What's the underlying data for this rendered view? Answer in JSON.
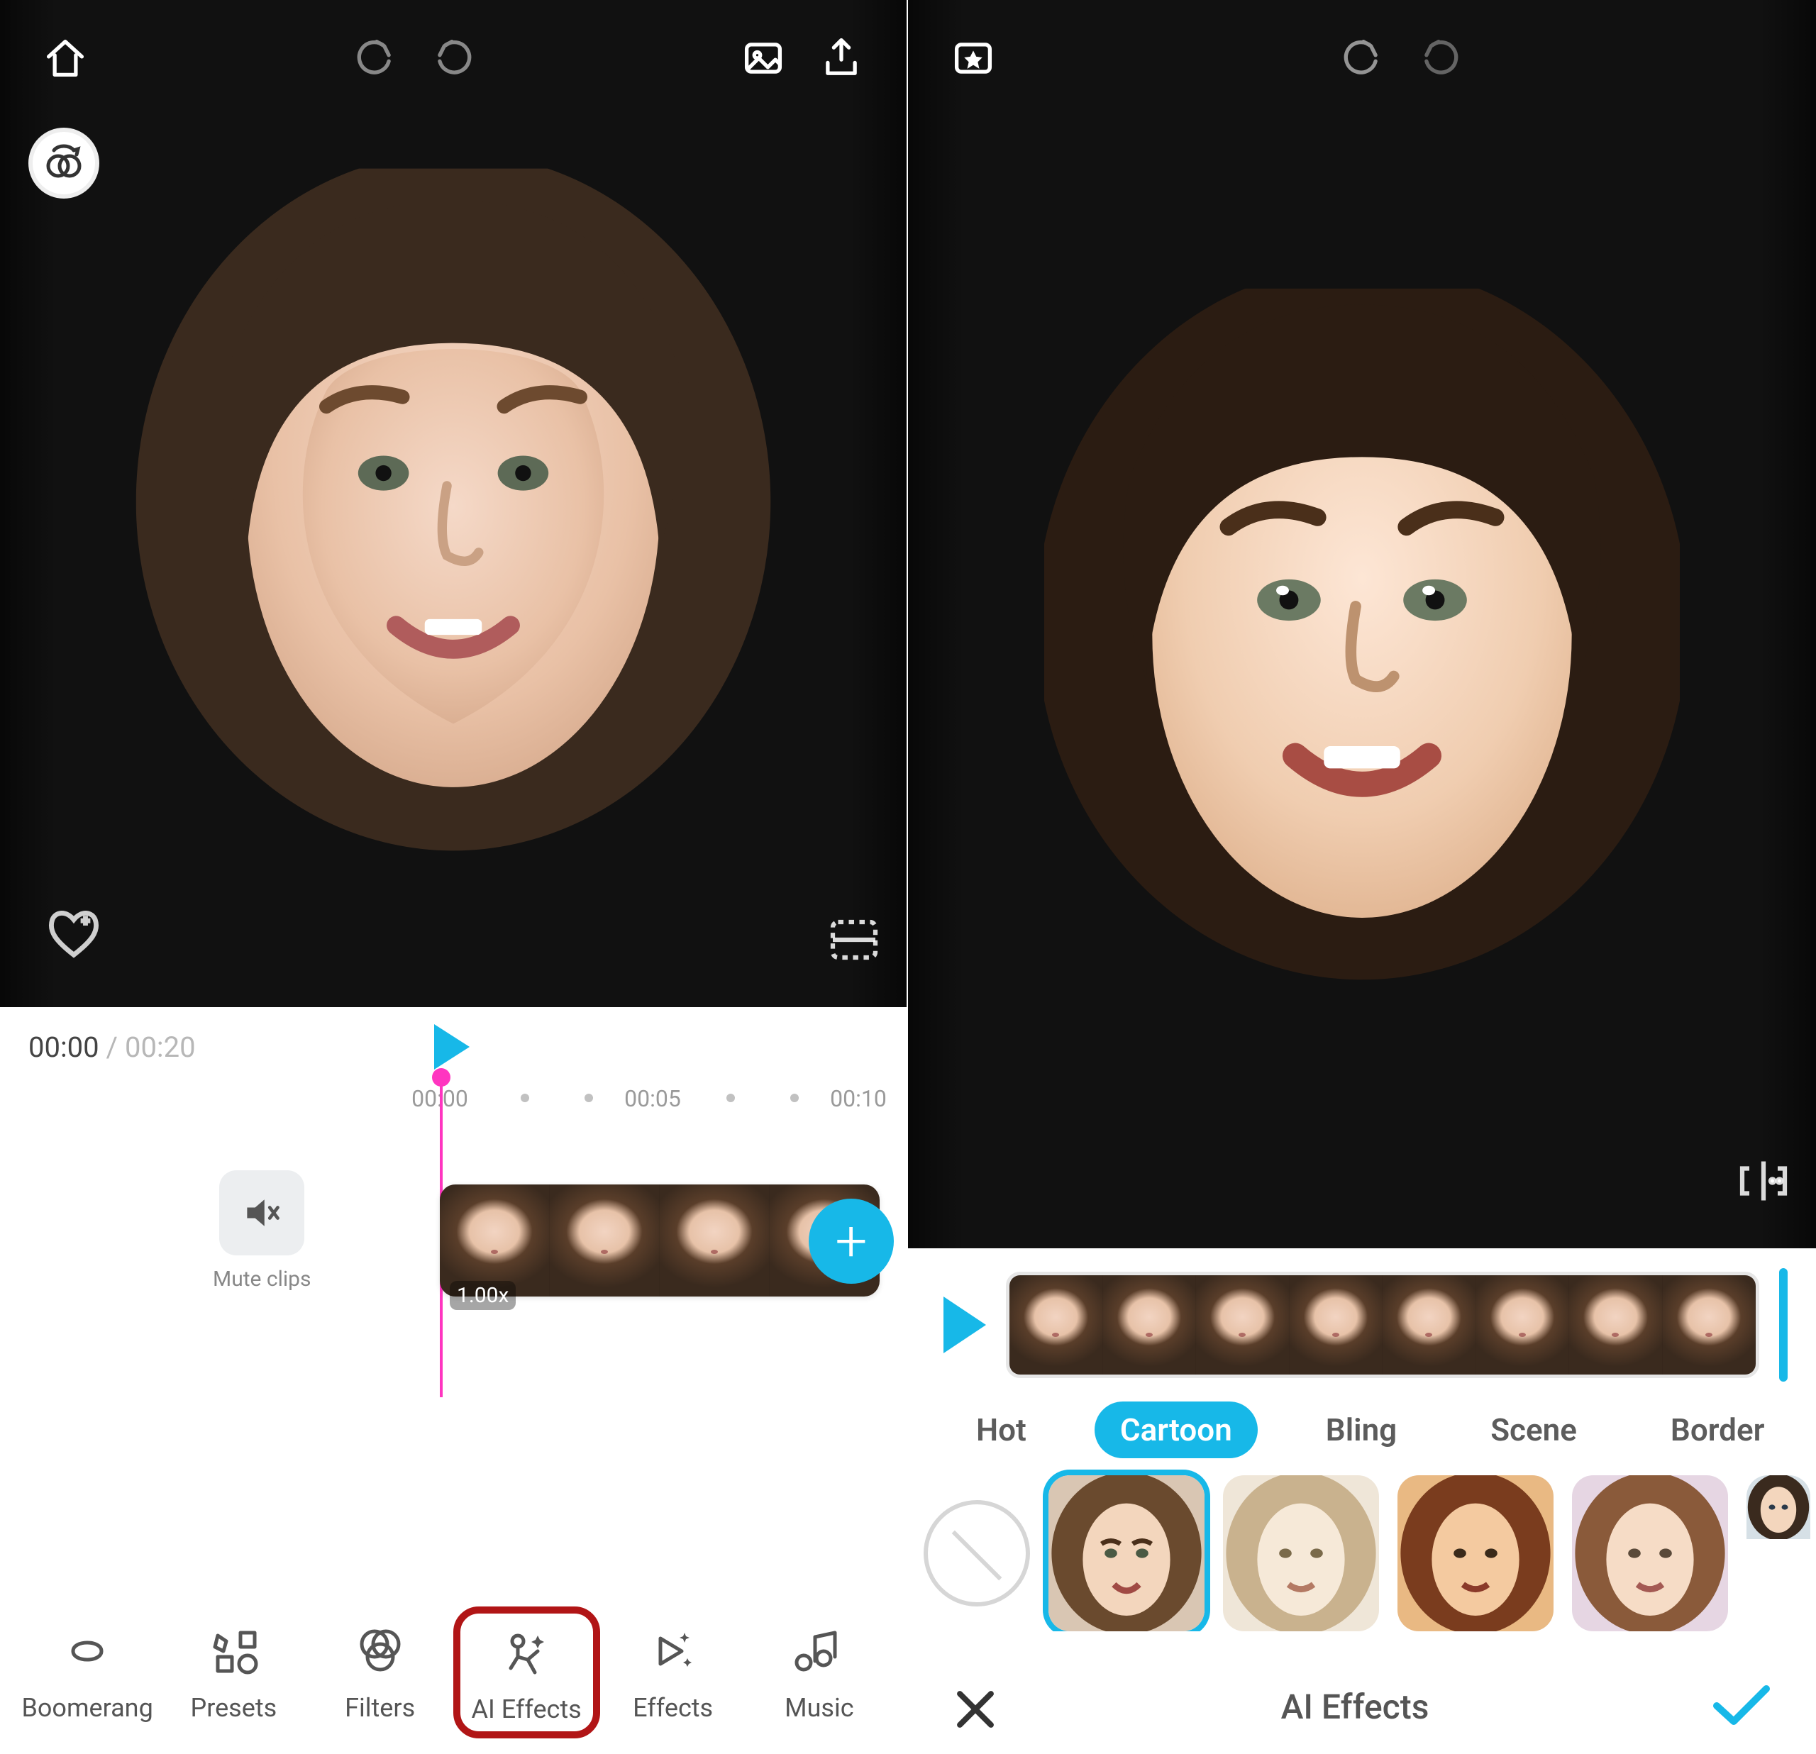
{
  "left": {
    "topbar": [
      "home",
      "undo",
      "redo",
      "gallery",
      "export"
    ],
    "time_current": "00:00",
    "time_total": "00:20",
    "ruler_ticks": [
      "00:00",
      "00:05",
      "00:10"
    ],
    "mute_label": "Mute clips",
    "clip_speed": "1.00x",
    "tools": [
      {
        "id": "boomerang",
        "label": "Boomerang"
      },
      {
        "id": "presets",
        "label": "Presets"
      },
      {
        "id": "filters",
        "label": "Filters"
      },
      {
        "id": "ai-effects",
        "label": "AI Effects",
        "highlight": true
      },
      {
        "id": "effects",
        "label": "Effects"
      },
      {
        "id": "music",
        "label": "Music"
      }
    ]
  },
  "right": {
    "topbar": [
      "library",
      "undo",
      "redo"
    ],
    "categories": [
      {
        "id": "hot",
        "label": "Hot"
      },
      {
        "id": "cartoon",
        "label": "Cartoon",
        "active": true
      },
      {
        "id": "bling",
        "label": "Bling"
      },
      {
        "id": "scene",
        "label": "Scene"
      },
      {
        "id": "border",
        "label": "Border"
      }
    ],
    "effects_count": 5,
    "selected_effect_index": 0,
    "panel_title": "AI Effects"
  },
  "colors": {
    "accent": "#17b8e8",
    "playhead": "#ff35c0",
    "highlight_border": "#b11516"
  }
}
